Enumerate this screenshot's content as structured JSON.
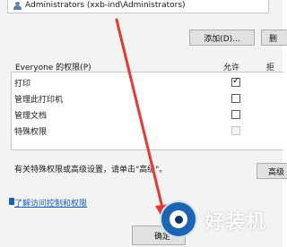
{
  "principal": {
    "name": "Administrators (xxb-ind\\Administrators)"
  },
  "buttons": {
    "add": "添加(D)...",
    "remove": "删",
    "advanced": "高级",
    "ok": "确定"
  },
  "permissions": {
    "header": "Everyone 的权限(P)",
    "allow_header": "允许",
    "deny_header": "拒",
    "rows": [
      {
        "label": "打印",
        "allow": true,
        "disabled": false
      },
      {
        "label": "管理此打印机",
        "allow": false,
        "disabled": false
      },
      {
        "label": "管理文档",
        "allow": false,
        "disabled": false
      },
      {
        "label": "特殊权限",
        "allow": false,
        "disabled": true
      }
    ]
  },
  "note": "有关特殊权限或高级设置，请单击\"高级\"。",
  "link": "了解访问控制和权限",
  "watermark": {
    "text": "好装机"
  },
  "colors": {
    "arrow": "#e53935",
    "link": "#1a5fb4",
    "watermark_blue": "#1e64b4"
  }
}
